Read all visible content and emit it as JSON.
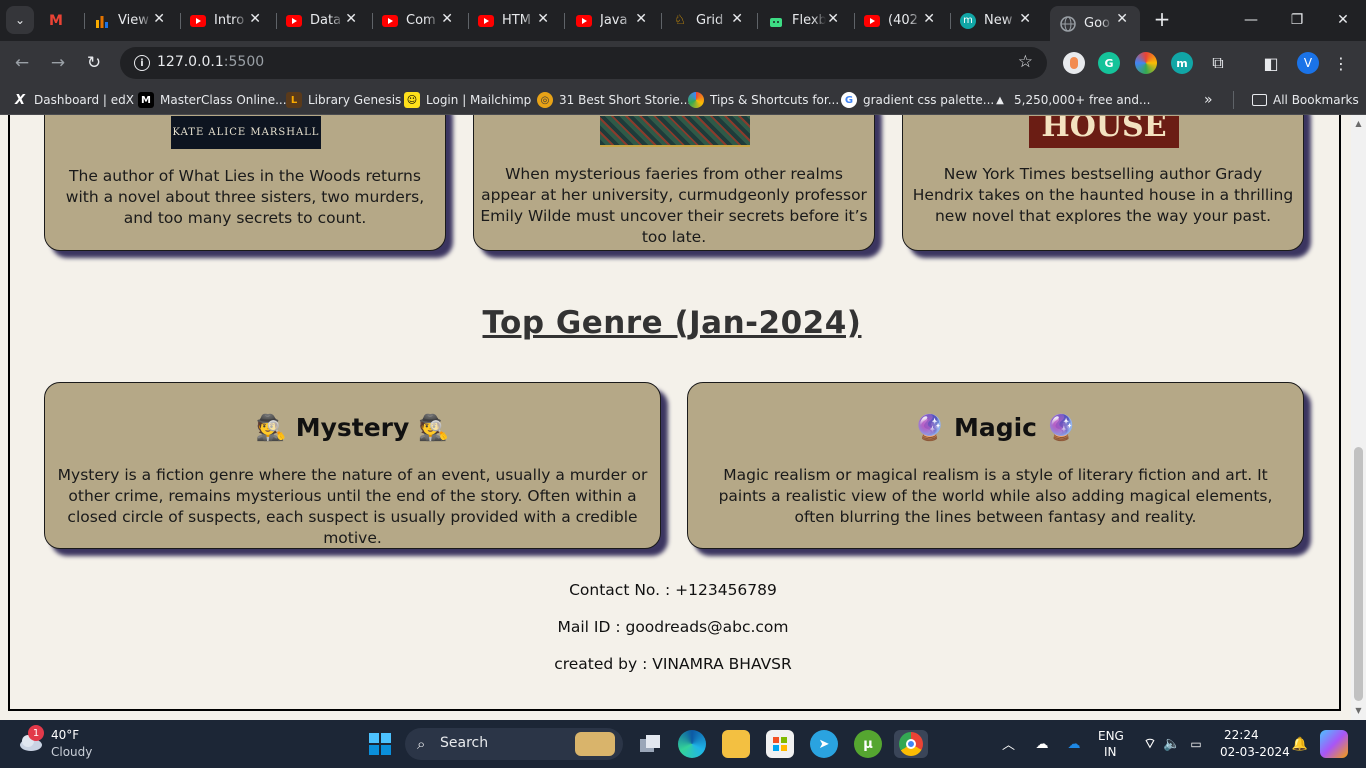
{
  "browser": {
    "tabs": [
      {
        "label": "",
        "icon": "gmail-icon"
      },
      {
        "label": "View",
        "icon": "bar-chart-icon"
      },
      {
        "label": "Intro",
        "icon": "youtube-icon"
      },
      {
        "label": "Data",
        "icon": "youtube-icon"
      },
      {
        "label": "Com",
        "icon": "youtube-icon"
      },
      {
        "label": "HTM",
        "icon": "youtube-icon"
      },
      {
        "label": "Java",
        "icon": "youtube-icon"
      },
      {
        "label": "Grid",
        "icon": "frog-icon"
      },
      {
        "label": "Flexb",
        "icon": "android-icon"
      },
      {
        "label": "(402",
        "icon": "youtube-icon"
      },
      {
        "label": "New",
        "icon": "m-logo-icon"
      },
      {
        "label": "Goo",
        "icon": "globe-icon",
        "active": true
      }
    ],
    "url_host": "127.0.0.1",
    "url_port": ":5500",
    "profile_initial": "V",
    "bookmarks": [
      {
        "label": "Dashboard | edX",
        "icon": "X"
      },
      {
        "label": "MasterClass Online...",
        "icon": "M"
      },
      {
        "label": "Library Genesis",
        "icon": "L"
      },
      {
        "label": "Login | Mailchimp",
        "icon": "☺"
      },
      {
        "label": "31 Best Short Storie...",
        "icon": "◎"
      },
      {
        "label": "Tips & Shortcuts for...",
        "icon": "G"
      },
      {
        "label": "gradient css palette...",
        "icon": "G"
      },
      {
        "label": "5,250,000+ free and...",
        "icon": "▲"
      }
    ],
    "all_bookmarks": "All Bookmarks"
  },
  "page": {
    "book_cards": [
      {
        "cover_text": "KATE ALICE MARSHALL",
        "description": "The author of What Lies in the Woods returns with a novel about three sisters, two murders, and too many secrets to count."
      },
      {
        "cover_text": "",
        "description": "When mysterious faeries from other realms appear at her university, curmudgeonly professor Emily Wilde must uncover their secrets before it’s too late."
      },
      {
        "cover_text": "HOUSE",
        "description": "New York Times bestselling author Grady Hendrix takes on the haunted house in a thrilling new novel that explores the way your past."
      }
    ],
    "genre_title": "Top Genre (Jan-2024)",
    "genres": [
      {
        "emoji": "🕵️",
        "name": "Mystery",
        "description": "Mystery is a fiction genre where the nature of an event, usually a murder or other crime, remains mysterious until the end of the story. Often within a closed circle of suspects, each suspect is usually provided with a credible motive."
      },
      {
        "emoji": "🔮",
        "name": "Magic",
        "description": "Magic realism or magical realism is a style of literary fiction and art. It paints a realistic view of the world while also adding magical elements, often blurring the lines between fantasy and reality."
      }
    ],
    "footer": {
      "contact": "Contact No. : +123456789",
      "mail": "Mail ID : goodreads@abc.com",
      "credit": "created by : VINAMRA BHAVSR"
    }
  },
  "taskbar": {
    "weather_temp": "40°F",
    "weather_desc": "Cloudy",
    "weather_badge": "1",
    "search_label": "Search",
    "lang_line1": "ENG",
    "lang_line2": "IN",
    "time": "22:24",
    "date": "02-03-2024"
  }
}
